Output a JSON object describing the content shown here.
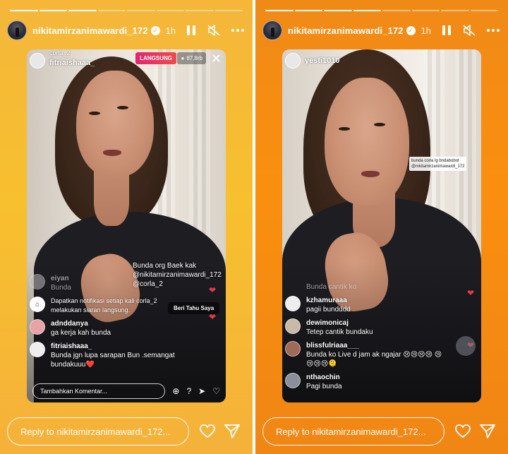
{
  "left": {
    "header": {
      "username": "nikitamirzanimawardi_172",
      "time": "1h"
    },
    "live": {
      "host_sub": "corla_2",
      "host": "fitriaishaaa_",
      "badge": "LANGSUNG",
      "viewers": "87,8rb"
    },
    "overlay_text": [
      "Bunda org Baek kak",
      "@nikitamirzanimawardi_172",
      "@corla_2"
    ],
    "faded_comment": {
      "user": "eiyan",
      "text": "Bunda"
    },
    "notification": "Dapatkan notifikasi setiap kali corla_2 melakukan siaran langsung.",
    "notify_button": "Beri Tahu Saya",
    "comments": [
      {
        "user": "adnddanya",
        "text": "ga kerja kah bunda"
      },
      {
        "user": "fitriaishaaa_",
        "text": "Bunda jgn lupa sarapan Bun .semangat bundakuuu❤️"
      }
    ],
    "comment_placeholder": "Tambahkan Komentar...",
    "reply_placeholder": "Reply to nikitamirzanimawardi_172..."
  },
  "right": {
    "header": {
      "username": "nikitamirzanimawardi_172",
      "time": "1h"
    },
    "live": {
      "host": "yesti1010"
    },
    "sticker_note": [
      "bunda corla lg bndabobot",
      "@nikitamirzanimawardi_172"
    ],
    "faded_comment": {
      "text": "Bunda cantik ko"
    },
    "comments": [
      {
        "user": "kzhamuraaa",
        "text": "pagii bundddd"
      },
      {
        "user": "dewimonicaj",
        "text": "Tetep cantik bundaku"
      },
      {
        "user": "blissfulriaaa___",
        "text": "Bunda ko Live d jam ak ngajar 😢😢😢😢 😢😢😢😢🫠"
      },
      {
        "user": "nthaochin",
        "text": "Pagi bunda"
      }
    ],
    "reply_placeholder": "Reply to nikitamirzanimawardi_172..."
  },
  "colors": {
    "left_bg": "#f7c02f",
    "right_bg": "#fa8f0f",
    "live_red": "#e02670"
  }
}
